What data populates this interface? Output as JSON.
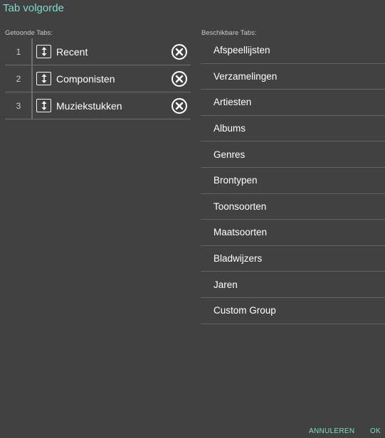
{
  "dialog": {
    "title": "Tab volgorde"
  },
  "shown_tabs": {
    "label": "Getoonde Tabs:",
    "rows": [
      {
        "index": "1",
        "label": "Recent"
      },
      {
        "index": "2",
        "label": "Componisten"
      },
      {
        "index": "3",
        "label": "Muziekstukken"
      }
    ]
  },
  "available_tabs": {
    "label": "Beschikbare Tabs:",
    "items": [
      "Afspeellijsten",
      "Verzamelingen",
      "Artiesten",
      "Albums",
      "Genres",
      "Brontypen",
      "Toonsoorten",
      "Maatsoorten",
      "Bladwijzers",
      "Jaren",
      "Custom Group"
    ]
  },
  "footer": {
    "cancel_label": "ANNULEREN",
    "ok_label": "OK"
  },
  "colors": {
    "background": "#414141",
    "accent": "#7fdcc9",
    "divider": "#6e6e6e"
  }
}
